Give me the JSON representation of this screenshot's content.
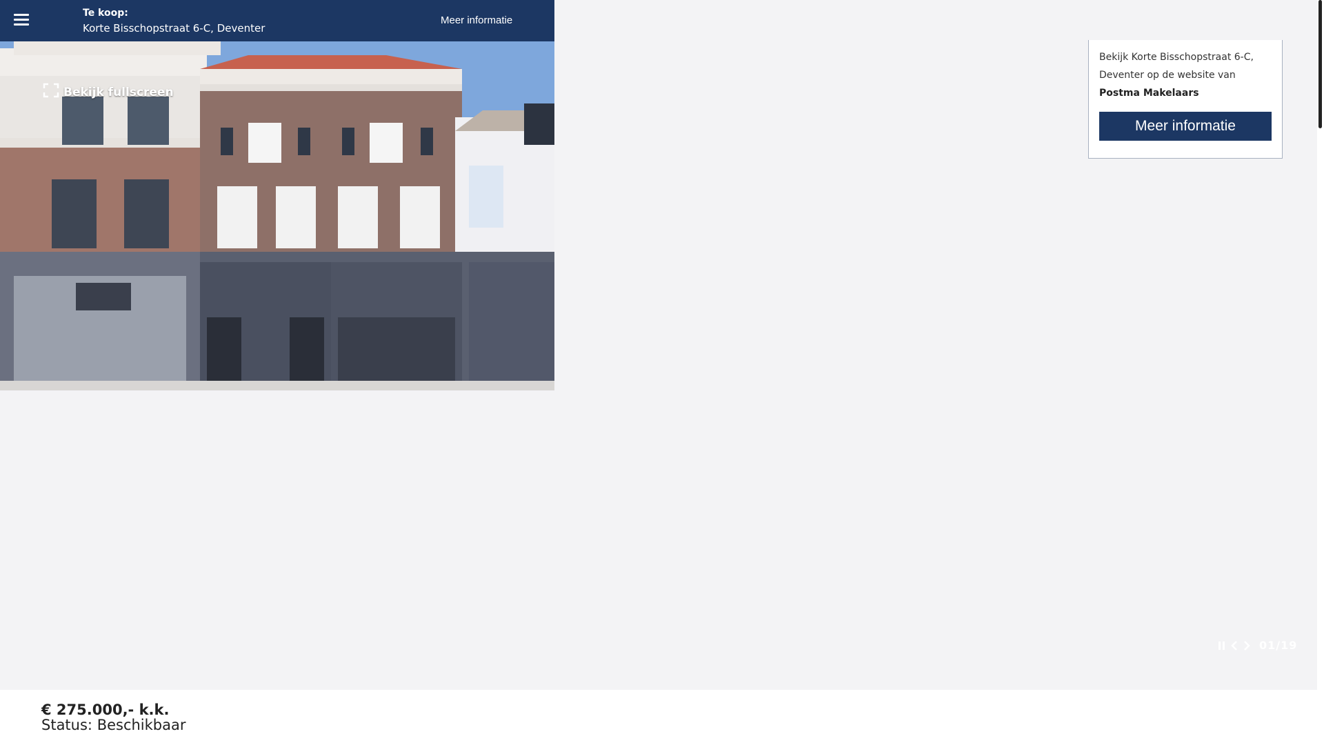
{
  "header": {
    "label": "Te koop:",
    "address": "Korte Bisschopstraat 6-C, Deventer",
    "more_info": "Meer informatie"
  },
  "gallery": {
    "fullscreen_label": "Bekijk fullscreen",
    "counter": "01/19"
  },
  "agent_card": {
    "line1": "Bekijk Korte Bisschopstraat 6-C,",
    "line2": "Deventer op de website van",
    "agent_name": "Postma Makelaars",
    "button_label": "Meer informatie"
  },
  "listing": {
    "price": "€ 275.000,- k.k.",
    "status_label": "Status:",
    "status_value": "Beschikbaar"
  },
  "colors": {
    "brand_navy": "#1c3763",
    "page_bg": "#f3f3f5"
  },
  "icons": {
    "menu": "hamburger-icon",
    "fullscreen": "fullscreen-icon",
    "pause": "pause-icon",
    "prev": "chevron-left-icon",
    "next": "chevron-right-icon"
  }
}
